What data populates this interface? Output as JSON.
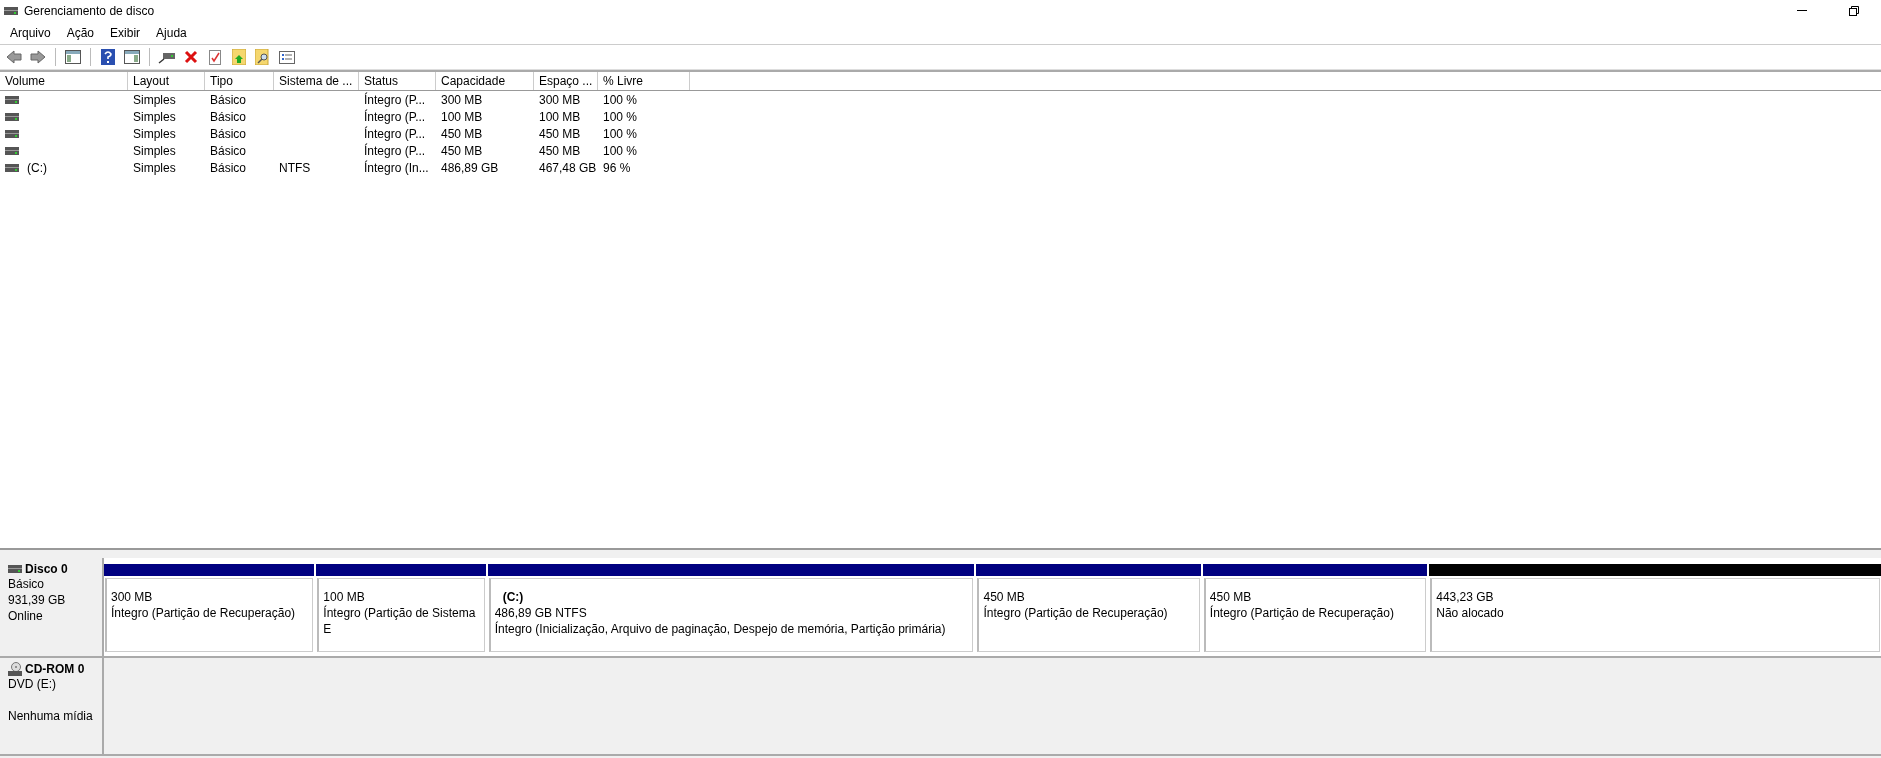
{
  "window": {
    "title": "Gerenciamento de disco"
  },
  "menu": [
    {
      "label": "Arquivo"
    },
    {
      "label": "Ação"
    },
    {
      "label": "Exibir"
    },
    {
      "label": "Ajuda"
    }
  ],
  "volume_table": {
    "columns": [
      "Volume",
      "Layout",
      "Tipo",
      "Sistema de ...",
      "Status",
      "Capacidade",
      "Espaço ...",
      "% Livre"
    ],
    "rows": [
      {
        "cells": [
          "",
          "Simples",
          "Básico",
          "",
          "Íntegro (P...",
          "300 MB",
          "300 MB",
          "100 %"
        ]
      },
      {
        "cells": [
          "",
          "Simples",
          "Básico",
          "",
          "Íntegro (P...",
          "100 MB",
          "100 MB",
          "100 %"
        ]
      },
      {
        "cells": [
          "",
          "Simples",
          "Básico",
          "",
          "Íntegro (P...",
          "450 MB",
          "450 MB",
          "100 %"
        ]
      },
      {
        "cells": [
          "",
          "Simples",
          "Básico",
          "",
          "Íntegro (P...",
          "450 MB",
          "450 MB",
          "100 %"
        ]
      },
      {
        "cells": [
          "(C:)",
          "Simples",
          "Básico",
          "NTFS",
          "Íntegro (In...",
          "486,89 GB",
          "467,48 GB",
          "96 %"
        ]
      }
    ]
  },
  "disks": [
    {
      "kind": "disk",
      "name": "Disco 0",
      "type": "Básico",
      "size": "931,39 GB",
      "status": "Online",
      "partitions": [
        {
          "kind": "primary",
          "size": "300 MB",
          "status": "Íntegro (Partição de Recuperação)"
        },
        {
          "kind": "primary",
          "size": "100 MB",
          "status": "Íntegro (Partição de Sistema E"
        },
        {
          "kind": "primary",
          "name": "(C:)",
          "size": "486,89 GB NTFS",
          "status": "Íntegro (Inicialização, Arquivo de paginação, Despejo de memória, Partição primária)"
        },
        {
          "kind": "primary",
          "size": "450 MB",
          "status": "Íntegro (Partição de Recuperação)"
        },
        {
          "kind": "primary",
          "size": "450 MB",
          "status": "Íntegro (Partição de Recuperação)"
        },
        {
          "kind": "unallocated",
          "size": "443,23 GB",
          "status": "Não alocado"
        }
      ]
    },
    {
      "kind": "cdrom",
      "name": "CD-ROM 0",
      "type": "DVD (E:)",
      "status": "Nenhuma mídia"
    }
  ]
}
